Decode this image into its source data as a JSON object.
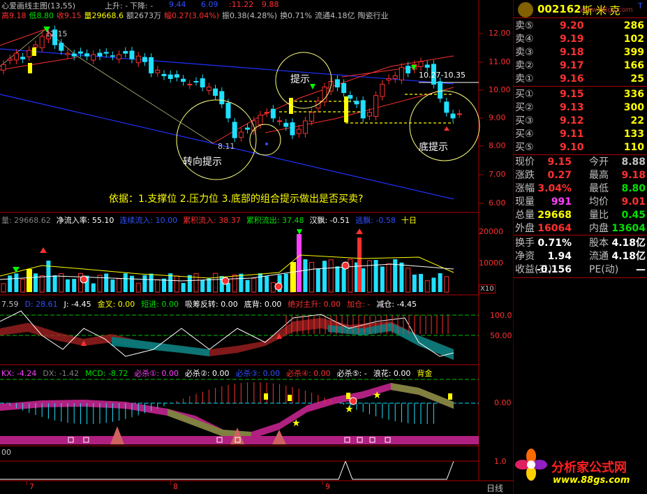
{
  "app": {
    "title": "心爱画线主图(13,55)"
  },
  "main_info": {
    "up_label": "上升: -",
    "down_label": "下降: -",
    "v1": "9.44",
    "v2": "6.09",
    "v3": ":11.22",
    "v4": "9.88",
    "stats": [
      {
        "t": "高9.18",
        "c": "#ff3030"
      },
      {
        "t": "低8.80",
        "c": "#00e000"
      },
      {
        "t": "收9.15",
        "c": "#ff3030"
      },
      {
        "t": "量29668.6",
        "c": "#ffff00"
      },
      {
        "t": "额2673万",
        "c": "#c0c0c0"
      },
      {
        "t": "幅0.27(3.04%)",
        "c": "#ff3030"
      },
      {
        "t": "振0.38(4.28%)",
        "c": "#c0c0c0"
      },
      {
        "t": "换0.71%",
        "c": "#c0c0c0"
      },
      {
        "t": "流通4.18亿",
        "c": "#c0c0c0"
      },
      {
        "t": "陶瓷行业",
        "c": "#c0c0c0"
      }
    ],
    "price_high": "12.15",
    "price_low": "8.11",
    "range_label": "10.27-10.35",
    "annotations": {
      "hint": "提示",
      "turn_hint": "转向提示",
      "bottom_hint": "底提示"
    },
    "question": "依据：1.支撑位 2.压力位 3.底部的组合提示做出是否买卖?",
    "y_ticks": [
      "12.00",
      "11.00",
      "10.00",
      "9.00",
      "8.00",
      "7.00",
      "6.00"
    ]
  },
  "volume_panel": {
    "labels": [
      {
        "t": "量: 29668.62",
        "c": "#808080"
      },
      {
        "t": "净流入率: 55.10",
        "c": "#ffffff"
      },
      {
        "t": "连续流入: 10.00",
        "c": "#3050ff"
      },
      {
        "t": "累积流入: 38.37",
        "c": "#ff3030"
      },
      {
        "t": "累积流出: 37.48",
        "c": "#00e000"
      },
      {
        "t": "汉飘: -0.51",
        "c": "#ffffff"
      },
      {
        "t": "逃飘: -0.58",
        "c": "#3050ff"
      },
      {
        "t": "十日",
        "c": "#ffff00"
      }
    ],
    "y_ticks": [
      "20000",
      "10000"
    ],
    "unit": "X10"
  },
  "kdj_panel": {
    "labels": [
      {
        "t": "7.59",
        "c": "#c0c0c0"
      },
      {
        "t": "D: 28.61",
        "c": "#3050ff"
      },
      {
        "t": "J: -4.45",
        "c": "#ffffff"
      },
      {
        "t": "金叉: 0.00",
        "c": "#ffff00"
      },
      {
        "t": "短进: 0.00",
        "c": "#00e000"
      },
      {
        "t": "吸筹反转: 0.00",
        "c": "#ffffff"
      },
      {
        "t": "底背: 0.00",
        "c": "#ffffff"
      },
      {
        "t": "绝对主升: 0.00",
        "c": "#ff3030"
      },
      {
        "t": "加仓: -",
        "c": "#ff3030"
      },
      {
        "t": "减仓: -4.45",
        "c": "#ffffff"
      }
    ],
    "y_ticks": [
      "100.0",
      "50.00"
    ]
  },
  "macd_panel": {
    "labels": [
      {
        "t": "KX: -4.24",
        "c": "#ff40ff"
      },
      {
        "t": "DX: -1.42",
        "c": "#808080"
      },
      {
        "t": "MCD: -8.72",
        "c": "#00e000"
      },
      {
        "t": "必杀①: 0.00",
        "c": "#ff40ff"
      },
      {
        "t": "必杀②: 0.00",
        "c": "#ffffff"
      },
      {
        "t": "必杀③: 0.00",
        "c": "#3050ff"
      },
      {
        "t": "必杀④: 0.00",
        "c": "#ff3030"
      },
      {
        "t": "必杀⑤: -",
        "c": "#ffffff"
      },
      {
        "t": "浪花: 0.00",
        "c": "#ffffff"
      },
      {
        "t": "背金",
        "c": "#ffff00"
      }
    ],
    "y_ticks": [
      "0.00"
    ]
  },
  "bottom_panel": {
    "left_label": "00",
    "y_tick": "1.0"
  },
  "date_axis": {
    "labels": [
      "7",
      "8",
      "9"
    ],
    "period": "日线"
  },
  "quote": {
    "code": "002162",
    "name": "斯 米 克",
    "sell": [
      {
        "label": "卖⑤",
        "price": "9.20",
        "vol": "286"
      },
      {
        "label": "卖④",
        "price": "9.19",
        "vol": "102"
      },
      {
        "label": "卖③",
        "price": "9.18",
        "vol": "399"
      },
      {
        "label": "卖②",
        "price": "9.17",
        "vol": "166"
      },
      {
        "label": "卖①",
        "price": "9.16",
        "vol": "25"
      }
    ],
    "buy": [
      {
        "label": "买①",
        "price": "9.15",
        "vol": "336"
      },
      {
        "label": "买②",
        "price": "9.13",
        "vol": "300"
      },
      {
        "label": "买③",
        "price": "9.12",
        "vol": "22"
      },
      {
        "label": "买④",
        "price": "9.11",
        "vol": "133"
      },
      {
        "label": "买⑤",
        "price": "9.10",
        "vol": "110"
      }
    ],
    "stats": [
      {
        "l1": "现价",
        "v1": "9.15",
        "c1": "#ff3030",
        "l2": "今开",
        "v2": "8.88",
        "c2": "#c0c0c0"
      },
      {
        "l1": "涨跌",
        "v1": "0.27",
        "c1": "#ff3030",
        "l2": "最高",
        "v2": "9.18",
        "c2": "#ff3030"
      },
      {
        "l1": "涨幅",
        "v1": "3.04%",
        "c1": "#ff3030",
        "l2": "最低",
        "v2": "8.80",
        "c2": "#00e000"
      },
      {
        "l1": "现量",
        "v1": "991",
        "c1": "#ff40ff",
        "l2": "均价",
        "v2": "9.01",
        "c2": "#ff3030"
      },
      {
        "l1": "总量",
        "v1": "29668",
        "c1": "#ffff00",
        "l2": "量比",
        "v2": "0.45",
        "c2": "#00e000"
      },
      {
        "l1": "外盘",
        "v1": "16064",
        "c1": "#ff3030",
        "l2": "内盘",
        "v2": "13604",
        "c2": "#00e000"
      }
    ],
    "stats2": [
      {
        "l1": "换手",
        "v1": "0.71%",
        "l2": "股本",
        "v2": "4.18亿"
      },
      {
        "l1": "净资",
        "v1": "1.94",
        "l2": "流通",
        "v2": "4.18亿"
      },
      {
        "l1": "收益(三)",
        "v1": "-0.156",
        "l2": "PE(动)",
        "v2": "—"
      }
    ],
    "watermark": "www.88gs.com",
    "logo": "分析家公式网",
    "logo_url": "www.88gs.com"
  }
}
